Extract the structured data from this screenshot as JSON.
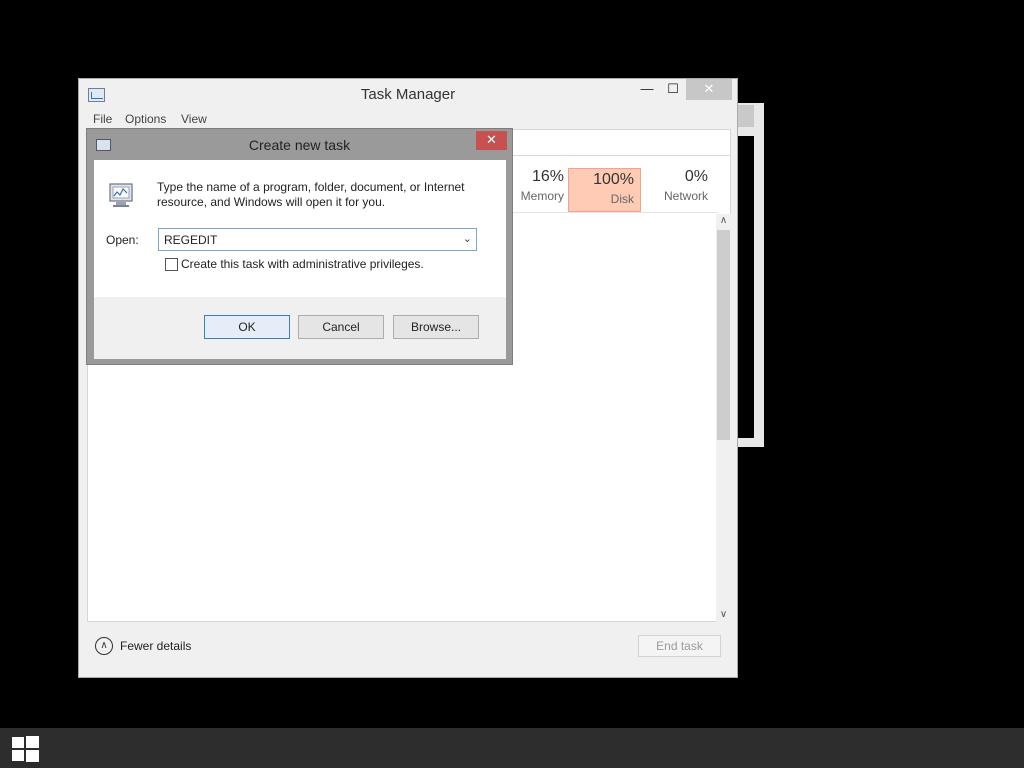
{
  "task_manager": {
    "title": "Task Manager",
    "minimize": "—",
    "maximize": "☐",
    "close": "✕",
    "menu": [
      "File",
      "Options",
      "View"
    ],
    "columns": [
      {
        "pct": "16%",
        "label": "Memory"
      },
      {
        "pct": "100%",
        "label": "Disk"
      },
      {
        "pct": "0%",
        "label": "Network"
      }
    ],
    "fewer_details": "Fewer details",
    "end_task": "End task",
    "highlight_color": "#ffcbb5"
  },
  "dialog": {
    "title": "Create new task",
    "close": "✕",
    "description": "Type the name of a program, folder, document, or Internet resource, and Windows will open it for you.",
    "open_label": "Open:",
    "open_value": "REGEDIT",
    "admin_label": "Create this task with administrative privileges.",
    "admin_checked": false,
    "ok": "OK",
    "cancel": "Cancel",
    "browse": "Browse..."
  },
  "icons": {
    "dropdown": "⌵",
    "scroll_up": "∧",
    "scroll_down": "∨",
    "collapse": "∧"
  }
}
